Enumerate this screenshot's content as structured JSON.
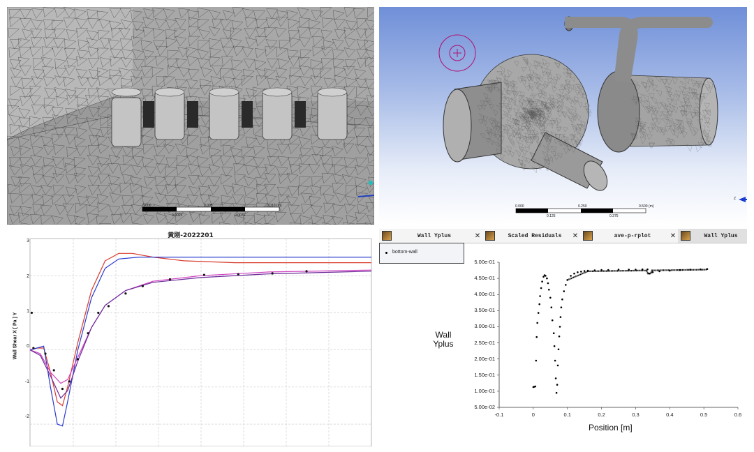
{
  "mesh_view": {
    "scale_labels": [
      "0.000",
      "0.005",
      "0.010 (m)",
      "0.0025",
      "0.0075"
    ]
  },
  "pipe_view": {
    "scale_labels": [
      "0.000",
      "0.250",
      "0.500 (m)",
      "0.125",
      "0.375"
    ],
    "axis_label": "Z"
  },
  "shear_plot": {
    "title": "黄刚-2022201",
    "ylabel": "Wall Shear X [ Pa ] Y",
    "yticks": [
      "3",
      "2",
      "1",
      "0",
      "-1",
      "-2"
    ],
    "colors": {
      "red": "#d83a2a",
      "blue": "#2a3ad0",
      "magenta": "#d040c0",
      "purple": "#6a2a9a"
    },
    "chart_data": {
      "type": "line",
      "ylim": [
        -2.6,
        3
      ],
      "series_count": 5
    }
  },
  "yplus_panel": {
    "tabs": [
      {
        "label": "Wall Yplus",
        "active": false
      },
      {
        "label": "Scaled Residuals",
        "active": false
      },
      {
        "label": "ave-p-rplot",
        "active": false
      },
      {
        "label": "Wall Yplus",
        "active": true
      }
    ],
    "legend": "bottom-wall",
    "ylabel_line1": "Wall",
    "ylabel_line2": "Yplus",
    "xlabel": "Position [m]",
    "yticks": [
      "5.00e-01",
      "4.50e-01",
      "4.00e-01",
      "3.50e-01",
      "3.00e-01",
      "2.50e-01",
      "2.00e-01",
      "1.50e-01",
      "1.00e-01",
      "5.00e-02"
    ],
    "xticks": [
      "-0.1",
      "0",
      "0.1",
      "0.2",
      "0.3",
      "0.4",
      "0.5",
      "0.6"
    ]
  },
  "chart_data": {
    "type": "scatter",
    "series": [
      {
        "name": "bottom-wall",
        "x": [
          0.0,
          0.003,
          0.006,
          0.008,
          0.01,
          0.012,
          0.015,
          0.018,
          0.02,
          0.023,
          0.026,
          0.03,
          0.033,
          0.036,
          0.04,
          0.043,
          0.046,
          0.05,
          0.053,
          0.056,
          0.06,
          0.062,
          0.064,
          0.066,
          0.068,
          0.07,
          0.072,
          0.074,
          0.076,
          0.078,
          0.08,
          0.082,
          0.085,
          0.09,
          0.095,
          0.1,
          0.11,
          0.12,
          0.13,
          0.14,
          0.15,
          0.16,
          0.18,
          0.2,
          0.22,
          0.25,
          0.28,
          0.3,
          0.32,
          0.335,
          0.34,
          0.35,
          0.37,
          0.4,
          0.43,
          0.46,
          0.49,
          0.51
        ],
        "y": [
          0.113,
          0.114,
          0.115,
          0.195,
          0.268,
          0.312,
          0.343,
          0.37,
          0.395,
          0.42,
          0.44,
          0.455,
          0.46,
          0.458,
          0.45,
          0.435,
          0.415,
          0.39,
          0.36,
          0.32,
          0.28,
          0.24,
          0.195,
          0.14,
          0.095,
          0.12,
          0.18,
          0.23,
          0.27,
          0.3,
          0.33,
          0.36,
          0.385,
          0.41,
          0.43,
          0.445,
          0.458,
          0.465,
          0.469,
          0.471,
          0.473,
          0.474,
          0.475,
          0.476,
          0.476,
          0.477,
          0.477,
          0.477,
          0.478,
          0.478,
          0.465,
          0.469,
          0.472,
          0.474,
          0.476,
          0.477,
          0.478,
          0.479
        ]
      }
    ],
    "xlim": [
      -0.1,
      0.6
    ],
    "ylim": [
      0.05,
      0.5
    ],
    "xlabel": "Position [m]",
    "ylabel": "Wall Yplus"
  }
}
